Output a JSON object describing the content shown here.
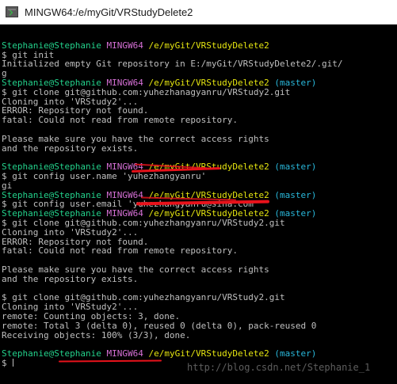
{
  "window": {
    "title": "MINGW64:/e/myGit/VRStudyDelete2",
    "icon": "terminal-icon"
  },
  "colors": {
    "background": "#000000",
    "text": "#c0c0c0",
    "user": "#23d18b",
    "env": "#d670d6",
    "path": "#e5e510",
    "branch": "#29b8db",
    "annotation": "#e8121b"
  },
  "terminal": {
    "blocks": [
      {
        "prompt": {
          "user": "Stephanie@Stephanie",
          "env": "MINGW64",
          "path": "/e/myGit/VRStudyDelete2",
          "branch": ""
        },
        "command": "$ git init",
        "output": [
          "Initialized empty Git repository in E:/myGit/VRStudyDelete2/.git/",
          "g"
        ]
      },
      {
        "prompt": {
          "user": "Stephanie@Stephanie",
          "env": "MINGW64",
          "path": "/e/myGit/VRStudyDelete2",
          "branch": "(master)"
        },
        "command": "$ git clone git@github.com:yuhezhanagyanru/VRStudy2.git",
        "output": [
          "Cloning into 'VRStudy2'...",
          "ERROR: Repository not found.",
          "fatal: Could not read from remote repository.",
          "",
          "Please make sure you have the correct access rights",
          "and the repository exists.",
          ""
        ]
      },
      {
        "prompt": {
          "user": "Stephanie@Stephanie",
          "env": "MINGW64",
          "path": "/e/myGit/VRStudyDelete2",
          "branch": "(master)"
        },
        "command": "$ git config user.name 'yuhezhangyanru'",
        "output": [
          "gi"
        ]
      },
      {
        "prompt": {
          "user": "Stephanie@Stephanie",
          "env": "MINGW64",
          "path": "/e/myGit/VRStudyDelete2",
          "branch": "(master)"
        },
        "command": "$ git config user.email 'yuhezhangyanru@sina.com'",
        "output": []
      },
      {
        "prompt": {
          "user": "Stephanie@Stephanie",
          "env": "MINGW64",
          "path": "/e/myGit/VRStudyDelete2",
          "branch": "(master)"
        },
        "command": "$ git clone git@github.com:yuhezhangyanru/VRStudy2.git",
        "output": [
          "Cloning into 'VRStudy2'...",
          "ERROR: Repository not found.",
          "fatal: Could not read from remote repository.",
          "",
          "Please make sure you have the correct access rights",
          "and the repository exists.",
          ""
        ]
      },
      {
        "prompt": null,
        "command": "$ git clone git@github.com:yuhezhangyanru/VRStudy2.git",
        "output": [
          "Cloning into 'VRStudy2'...",
          "remote: Counting objects: 3, done.",
          "remote: Total 3 (delta 0), reused 0 (delta 0), pack-reused 0",
          "Receiving objects: 100% (3/3), done.",
          ""
        ]
      },
      {
        "prompt": {
          "user": "Stephanie@Stephanie",
          "env": "MINGW64",
          "path": "/e/myGit/VRStudyDelete2",
          "branch": "(master)"
        },
        "command": "$ ",
        "output": []
      }
    ]
  },
  "watermark": "http://blog.csdn.net/Stephanie_1"
}
